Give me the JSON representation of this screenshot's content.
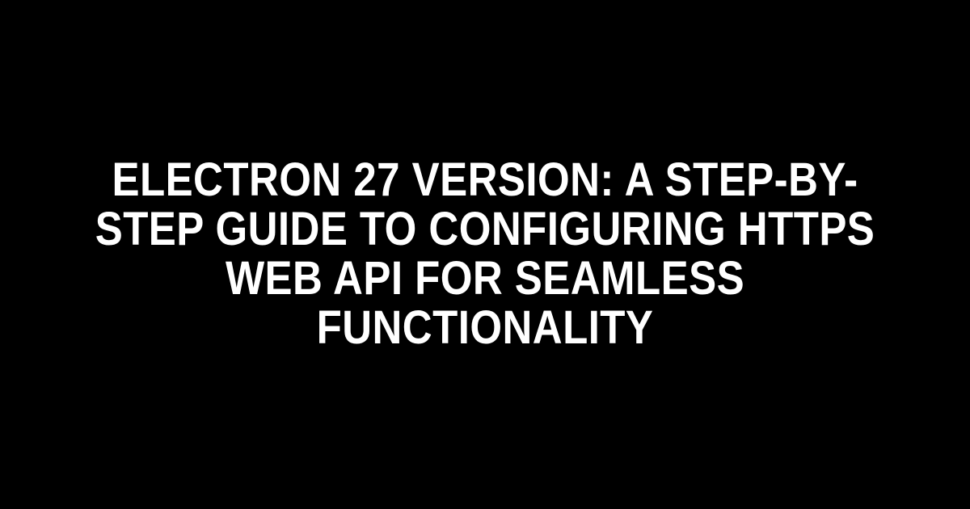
{
  "title": "Electron 27 Version: A Step-by-Step Guide to Configuring HTTPS Web API for Seamless Functionality"
}
